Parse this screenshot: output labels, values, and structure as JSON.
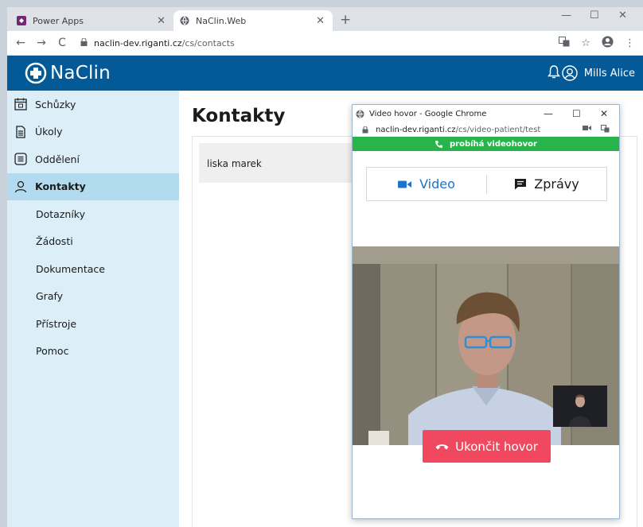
{
  "browser": {
    "tabs": [
      {
        "title": "Power Apps"
      },
      {
        "title": "NaClin.Web"
      }
    ],
    "url_host": "naclin-dev.riganti.cz",
    "url_path": "/cs/contacts"
  },
  "app": {
    "logo_text": "NaClin",
    "user_name": "Mills Alice",
    "brand_color": "#045a97"
  },
  "sidebar": {
    "items": [
      {
        "label": "Schůzky",
        "icon": "calendar-icon"
      },
      {
        "label": "Úkoly",
        "icon": "document-icon"
      },
      {
        "label": "Oddělení",
        "icon": "list-icon"
      },
      {
        "label": "Kontakty",
        "icon": "person-icon",
        "active": true
      },
      {
        "label": "Dotazníky"
      },
      {
        "label": "Žádosti"
      },
      {
        "label": "Dokumentace"
      },
      {
        "label": "Grafy"
      },
      {
        "label": "Přístroje"
      },
      {
        "label": "Pomoc"
      }
    ]
  },
  "main": {
    "title": "Kontakty",
    "contacts": [
      "liska marek"
    ]
  },
  "popup": {
    "window_title": "Video hovor - Google Chrome",
    "url_host": "naclin-dev.riganti.cz",
    "url_path": "/cs/video-patient/test",
    "call_status": "probíhá videohovor",
    "tab_video": "Video",
    "tab_messages": "Zprávy",
    "end_call": "Ukončit hovor",
    "status_color": "#28b44b",
    "end_color": "#f0485e"
  }
}
